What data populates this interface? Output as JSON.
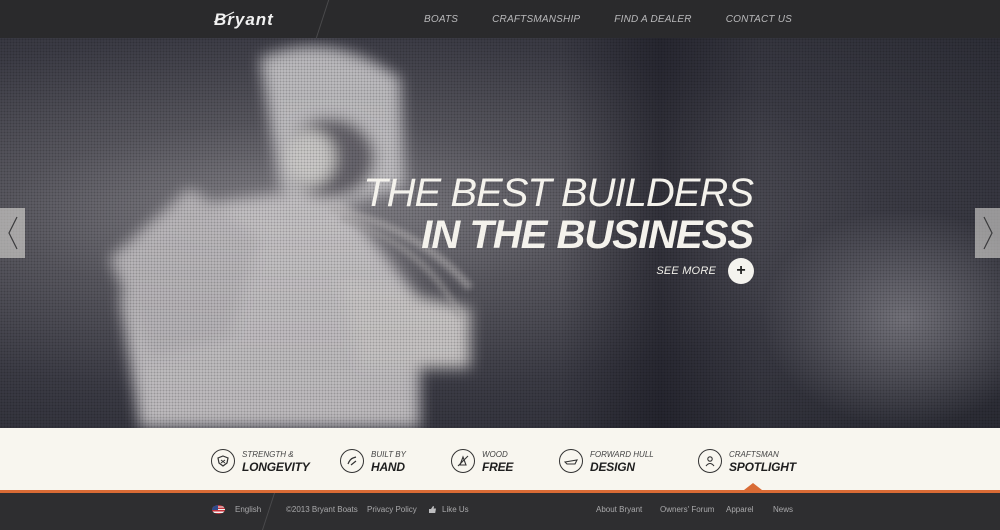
{
  "header": {
    "logo_text": "Bryant",
    "nav": [
      "BOATS",
      "CRAFTSMANSHIP",
      "FIND A DEALER",
      "CONTACT US"
    ]
  },
  "hero": {
    "headline_line1": "THE BEST BUILDERS",
    "headline_line2": "IN THE BUSINESS",
    "see_more": "SEE MORE",
    "plus_symbol": "+"
  },
  "features": [
    {
      "small": "STRENGTH &",
      "big": "LONGEVITY",
      "icon": "shield-icon"
    },
    {
      "small": "BUILT BY",
      "big": "HAND",
      "icon": "hand-icon"
    },
    {
      "small": "WOOD",
      "big": "FREE",
      "icon": "no-wood-icon"
    },
    {
      "small": "FORWARD HULL",
      "big": "DESIGN",
      "icon": "hull-icon"
    },
    {
      "small": "CRAFTSMAN",
      "big": "SPOTLIGHT",
      "icon": "craftsman-icon"
    }
  ],
  "footer": {
    "language": "English",
    "copyright": "©2013 Bryant Boats",
    "privacy": "Privacy Policy",
    "like": "Like Us",
    "links": [
      "About Bryant",
      "Owners' Forum",
      "Apparel",
      "News"
    ]
  },
  "colors": {
    "accent": "#d96b35",
    "header_bg": "#2a2a2c",
    "features_bg": "#f8f6ef"
  }
}
